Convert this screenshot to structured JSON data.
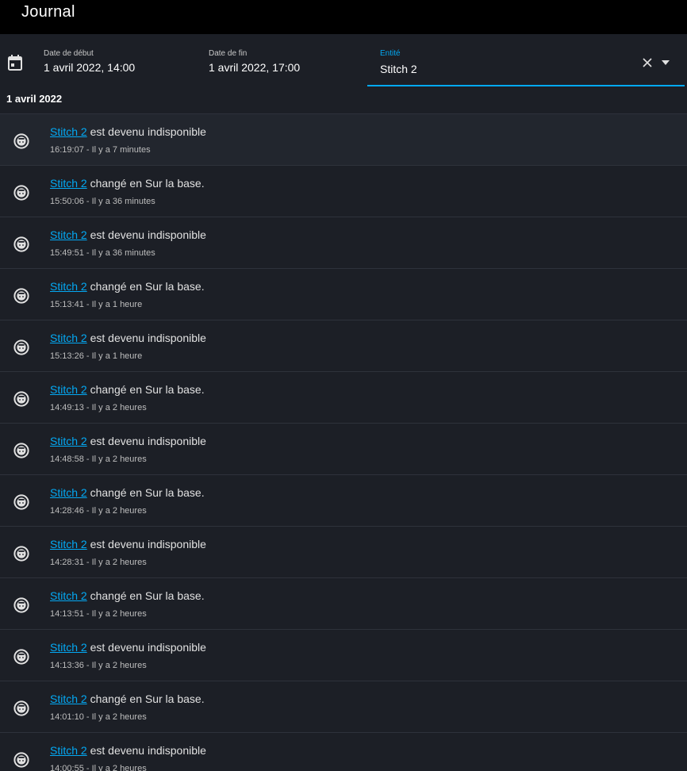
{
  "header": {
    "title": "Journal"
  },
  "filters": {
    "start": {
      "label": "Date de début",
      "value": "1 avril 2022, 14:00"
    },
    "end": {
      "label": "Date de fin",
      "value": "1 avril 2022, 17:00"
    },
    "entity": {
      "label": "Entité",
      "value": "Stitch 2"
    },
    "accent_color": "#03a9f4"
  },
  "day_header": "1 avril 2022",
  "entries": [
    {
      "entity": "Stitch 2",
      "message": " est devenu indisponible",
      "time": "16:19:07",
      "relative": " - Il y a 7 minutes"
    },
    {
      "entity": "Stitch 2",
      "message": " changé en Sur la base.",
      "time": "15:50:06",
      "relative": " - Il y a 36 minutes"
    },
    {
      "entity": "Stitch 2",
      "message": " est devenu indisponible",
      "time": "15:49:51",
      "relative": " - Il y a 36 minutes"
    },
    {
      "entity": "Stitch 2",
      "message": " changé en Sur la base.",
      "time": "15:13:41",
      "relative": " - Il y a 1 heure"
    },
    {
      "entity": "Stitch 2",
      "message": " est devenu indisponible",
      "time": "15:13:26",
      "relative": " - Il y a 1 heure"
    },
    {
      "entity": "Stitch 2",
      "message": " changé en Sur la base.",
      "time": "14:49:13",
      "relative": " - Il y a 2 heures"
    },
    {
      "entity": "Stitch 2",
      "message": " est devenu indisponible",
      "time": "14:48:58",
      "relative": " - Il y a 2 heures"
    },
    {
      "entity": "Stitch 2",
      "message": " changé en Sur la base.",
      "time": "14:28:46",
      "relative": " - Il y a 2 heures"
    },
    {
      "entity": "Stitch 2",
      "message": " est devenu indisponible",
      "time": "14:28:31",
      "relative": " - Il y a 2 heures"
    },
    {
      "entity": "Stitch 2",
      "message": " changé en Sur la base.",
      "time": "14:13:51",
      "relative": " - Il y a 2 heures"
    },
    {
      "entity": "Stitch 2",
      "message": " est devenu indisponible",
      "time": "14:13:36",
      "relative": " - Il y a 2 heures"
    },
    {
      "entity": "Stitch 2",
      "message": " changé en Sur la base.",
      "time": "14:01:10",
      "relative": " - Il y a 2 heures"
    },
    {
      "entity": "Stitch 2",
      "message": " est devenu indisponible",
      "time": "14:00:55",
      "relative": " - Il y a 2 heures"
    }
  ],
  "icons": {
    "calendar": "calendar-icon",
    "clear": "close-icon",
    "dropdown": "menu-down-icon",
    "entry": "robot-vacuum-icon"
  }
}
